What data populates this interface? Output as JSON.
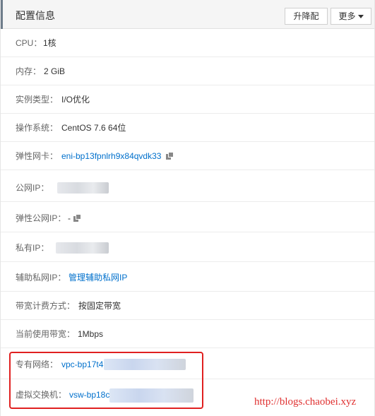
{
  "header": {
    "title": "配置信息",
    "upgrade_label": "升降配",
    "more_label": "更多"
  },
  "rows": [
    {
      "label": "CPU：",
      "value": "1核"
    },
    {
      "label": "内存：",
      "value": "2 GiB"
    },
    {
      "label": "实例类型：",
      "value": "I/O优化"
    },
    {
      "label": "操作系统：",
      "value": "CentOS 7.6 64位"
    },
    {
      "label": "弹性网卡：",
      "value": "eni-bp13fpnlrh9x84qvdk33"
    },
    {
      "label": "公网IP：",
      "value": ""
    },
    {
      "label": "弹性公网IP：",
      "value": "-"
    },
    {
      "label": "私有IP：",
      "value": ""
    },
    {
      "label": "辅助私网IP：",
      "value": "管理辅助私网IP"
    },
    {
      "label": "带宽计费方式：",
      "value": "按固定带宽"
    },
    {
      "label": "当前使用带宽：",
      "value": "1Mbps"
    },
    {
      "label": "专有网络：",
      "value": "vpc-bp17t4"
    },
    {
      "label": "虚拟交换机：",
      "value": "vsw-bp18c"
    }
  ],
  "watermark": "http://blogs.chaobei.xyz",
  "colors": {
    "link": "#0070cc",
    "highlight_border": "#e02020",
    "watermark": "#e03030"
  }
}
